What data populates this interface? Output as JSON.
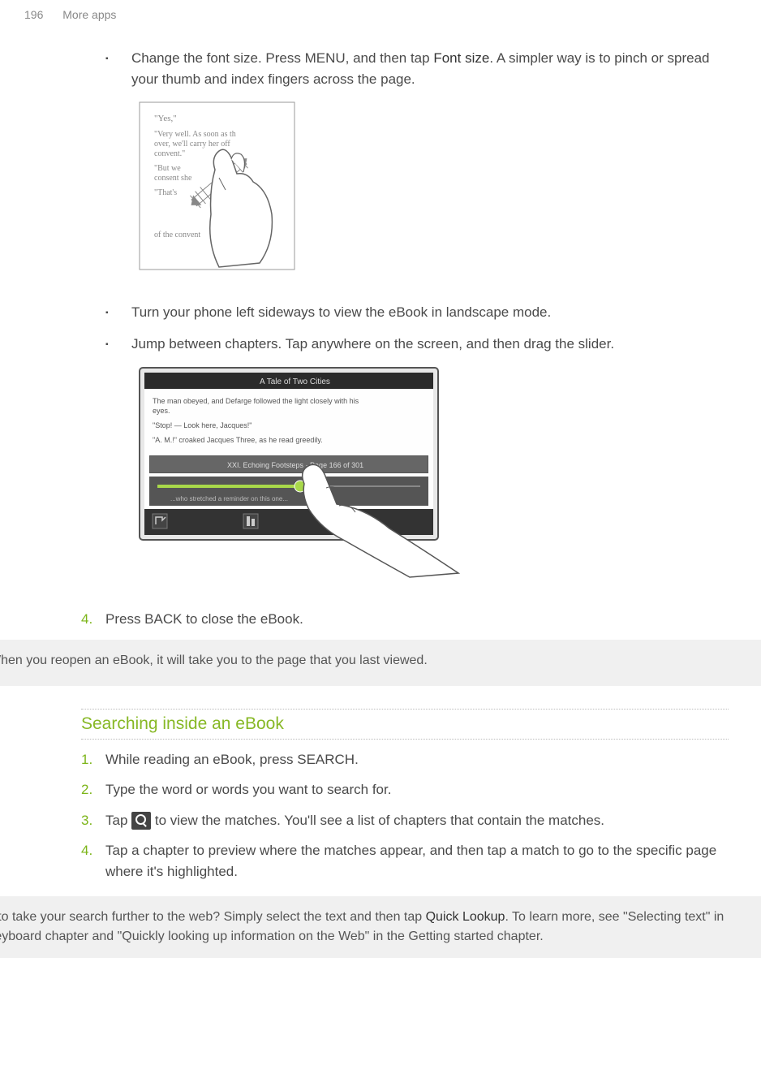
{
  "header": {
    "page_number": "196",
    "section": "More apps"
  },
  "bullets": {
    "font_size_pre": "Change the font size. Press MENU, and then tap ",
    "font_size_bold": "Font size",
    "font_size_post": ". A simpler way is to pinch or spread your thumb and index fingers across the page.",
    "landscape": "Turn your phone left sideways to view the eBook in landscape mode.",
    "chapters": "Jump between chapters. Tap anywhere on the screen, and then drag the slider."
  },
  "step4_close": "Press BACK to close the eBook.",
  "note_reopen": "When you reopen an eBook, it will take you to the page that you last viewed.",
  "heading_search": "Searching inside an eBook",
  "search_steps": {
    "s1": "While reading an eBook, press SEARCH.",
    "s2": "Type the word or words you want to search for.",
    "s3_pre": "Tap ",
    "s3_post": " to view the matches. You'll see a list of chapters that contain the matches.",
    "s4": "Tap a chapter to preview where the matches appear, and then tap a match to go to the specific page where it's highlighted."
  },
  "tip": {
    "pre": "Want to take your search further to the web? Simply select the text and then tap ",
    "bold": "Quick Lookup",
    "post": ". To learn more, see \"Selecting text\" in the Keyboard chapter and \"Quickly looking up information on the Web\" in the Getting started chapter."
  },
  "nums": {
    "n1": "1.",
    "n2": "2.",
    "n3": "3.",
    "n4": "4."
  },
  "bullet_glyph": "▪"
}
